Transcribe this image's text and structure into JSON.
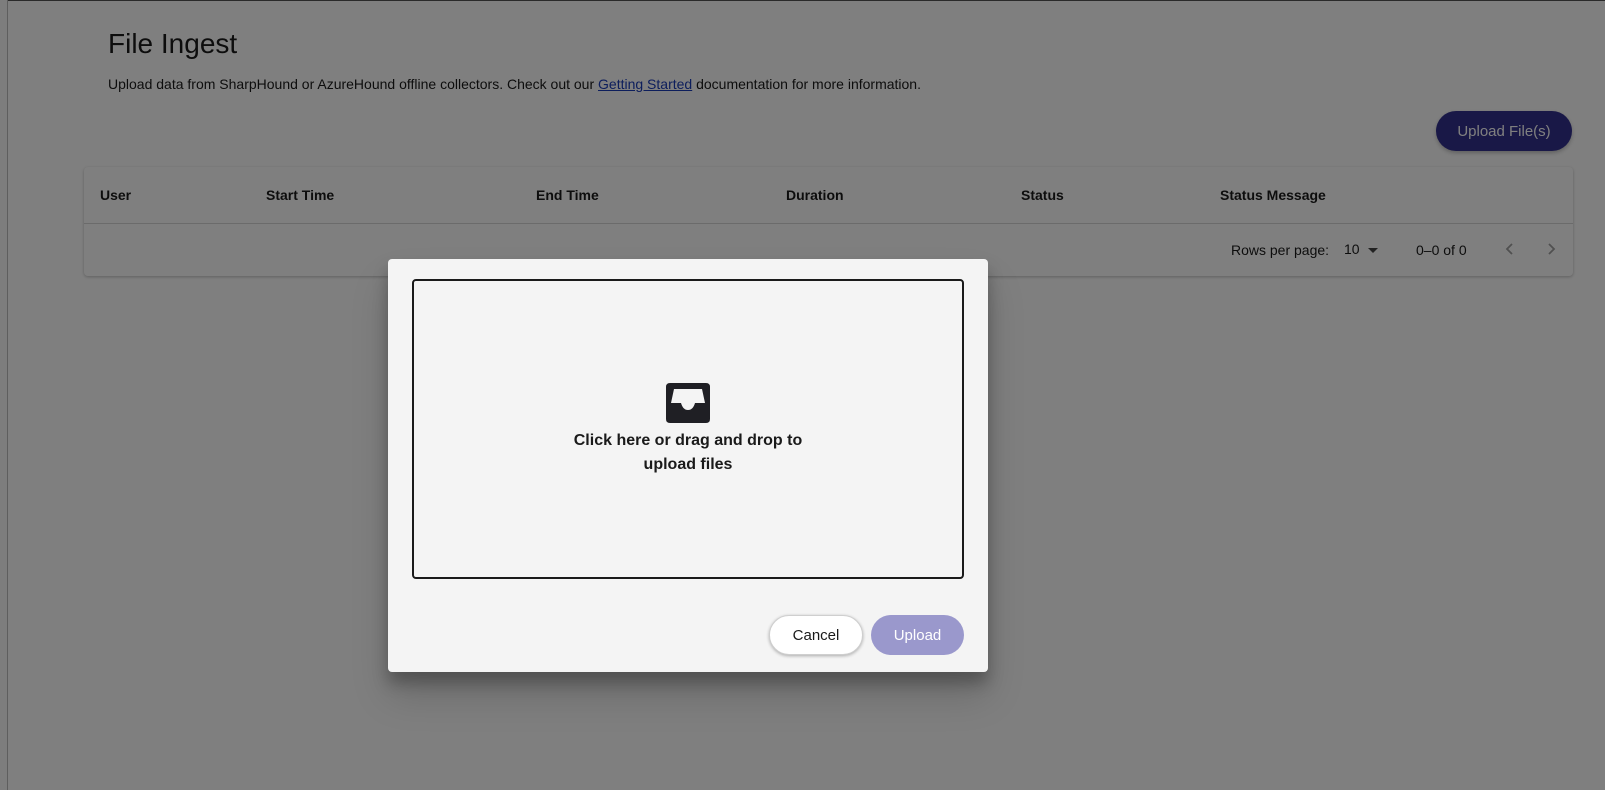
{
  "page": {
    "title": "File Ingest",
    "description_prefix": "Upload data from SharpHound or AzureHound offline collectors. Check out our ",
    "description_link": "Getting Started",
    "description_suffix": " documentation for more information.",
    "upload_files_label": "Upload File(s)"
  },
  "table": {
    "columns": [
      "User",
      "Start Time",
      "End Time",
      "Duration",
      "Status",
      "Status Message"
    ],
    "rows": [],
    "rows_per_page_label": "Rows per page:",
    "rows_per_page_value": "10",
    "range_text": "0–0 of 0"
  },
  "dialog": {
    "dropzone_text": "Click here or drag and drop to upload files",
    "cancel_label": "Cancel",
    "upload_label": "Upload"
  },
  "colors": {
    "primary": "#33318f",
    "primary_disabled": "#9a98cc",
    "link": "#1a3cb8"
  },
  "icons": {
    "dropzone": "inbox-icon",
    "prev_page": "chevron-left-icon",
    "next_page": "chevron-right-icon",
    "rows_select": "caret-down-icon"
  }
}
